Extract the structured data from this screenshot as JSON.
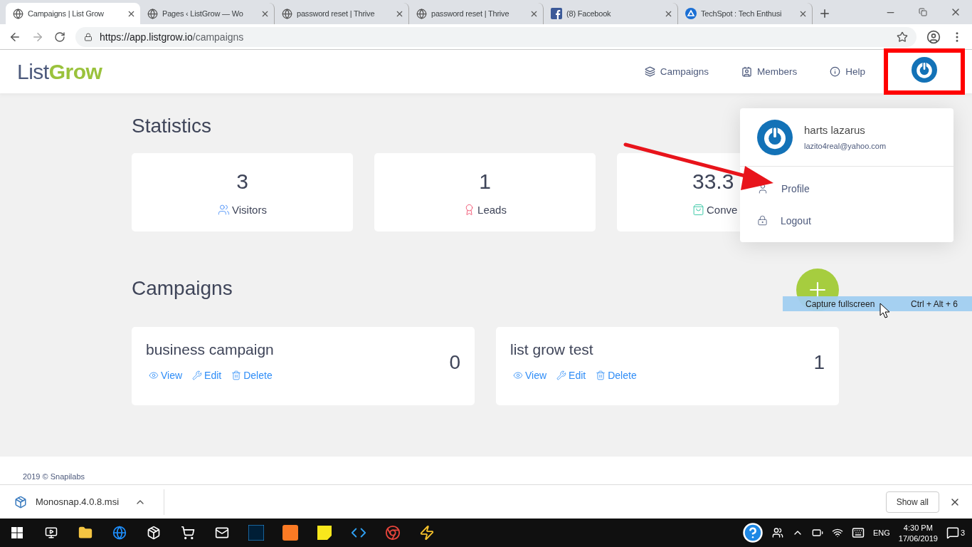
{
  "browser": {
    "tabs": [
      {
        "title": "Campaigns | List Grow",
        "selected": true,
        "kind": "globe"
      },
      {
        "title": "Pages ‹ ListGrow — Wo",
        "selected": false,
        "kind": "globe"
      },
      {
        "title": "password reset | Thrive",
        "selected": false,
        "kind": "globe"
      },
      {
        "title": "password reset | Thrive",
        "selected": false,
        "kind": "globe"
      },
      {
        "title": "(8) Facebook",
        "selected": false,
        "kind": "facebook"
      },
      {
        "title": "TechSpot : Tech Enthusi",
        "selected": false,
        "kind": "techspot"
      }
    ],
    "url_host": "https://app.listgrow.io",
    "url_path": "/campaigns"
  },
  "header": {
    "logo_a": "List",
    "logo_b": "Grow",
    "nav": [
      {
        "label": "Campaigns",
        "kind": "campaigns"
      },
      {
        "label": "Members",
        "kind": "members"
      },
      {
        "label": "Help",
        "kind": "help"
      }
    ]
  },
  "user_menu": {
    "name": "harts lazarus",
    "email": "lazito4real@yahoo.com",
    "items": [
      {
        "label": "Profile",
        "kind": "profile"
      },
      {
        "label": "Logout",
        "kind": "logout"
      }
    ]
  },
  "statistics": {
    "title": "Statistics",
    "cards": [
      {
        "value": "3",
        "label": "Visitors",
        "kind": "visitors"
      },
      {
        "value": "1",
        "label": "Leads",
        "kind": "leads"
      },
      {
        "value": "33.3",
        "label": "Conve",
        "kind": "conversion"
      }
    ]
  },
  "campaigns": {
    "title": "Campaigns",
    "items": [
      {
        "name": "business campaign",
        "count": "0",
        "actions": [
          "View",
          "Edit",
          "Delete"
        ]
      },
      {
        "name": "list grow test",
        "count": "1",
        "actions": [
          "View",
          "Edit",
          "Delete"
        ]
      }
    ]
  },
  "tooltip": {
    "label": "Capture fullscreen",
    "shortcut": "Ctrl + Alt + 6"
  },
  "footer": "2019 © Snapilabs",
  "download": {
    "file": "Monosnap.4.0.8.msi",
    "show_all": "Show all"
  },
  "taskbar": {
    "language": "ENG",
    "time": "4:30 PM",
    "date": "17/06/2019",
    "notifications": "3"
  }
}
